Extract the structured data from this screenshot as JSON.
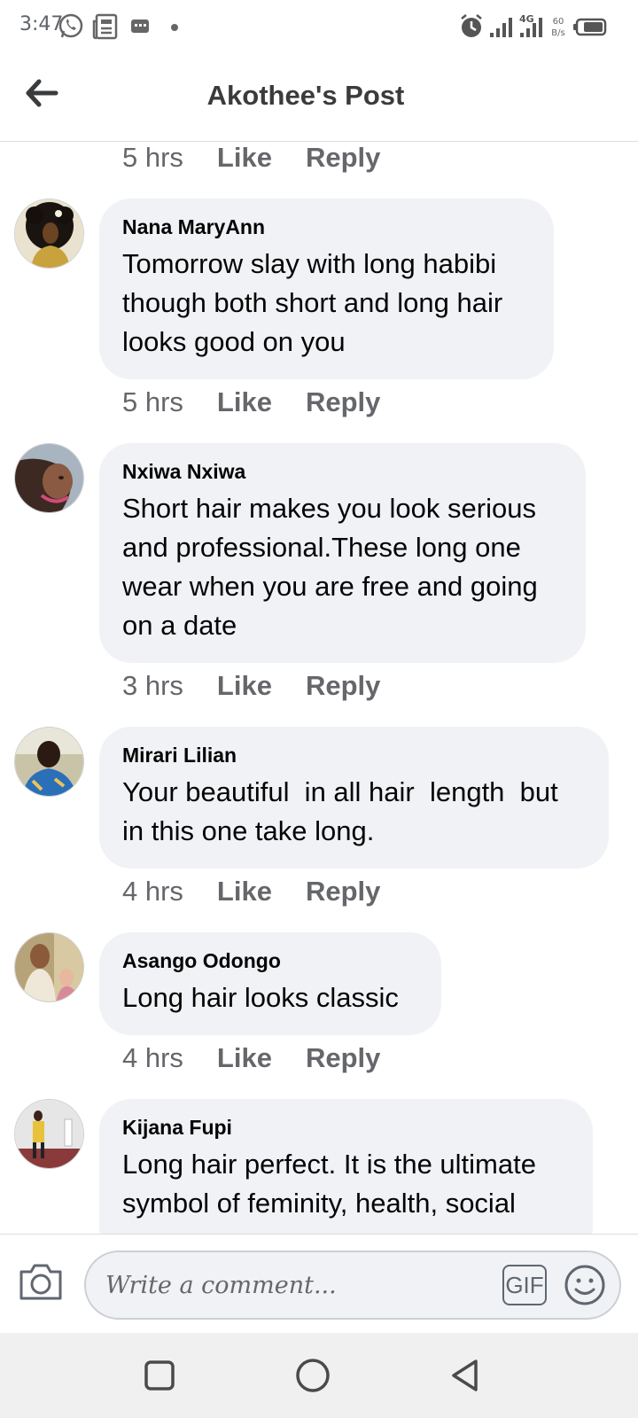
{
  "status_bar": {
    "time": "3:47",
    "icons": [
      "whatsapp-icon",
      "news-icon",
      "message-icon",
      "alarm-icon",
      "signal-icon",
      "signal-4g-icon",
      "data-speed-icon",
      "battery-icon"
    ],
    "network": "4G",
    "speed": "60 B/s"
  },
  "header": {
    "title": "Akothee's Post",
    "back_icon": "back-arrow-icon"
  },
  "top_action_row": {
    "time": "5 hrs",
    "like": "Like",
    "reply": "Reply"
  },
  "comments": [
    {
      "author": "Nana MaryAnn",
      "text": "Tomorrow slay with long habibi\nthough both short and long hair\nlooks good on you",
      "time": "5 hrs",
      "like": "Like",
      "reply": "Reply"
    },
    {
      "author": "Nxiwa Nxiwa",
      "text": "Short hair makes you look serious\nand professional.These long one\nwear when you are free and going\non a date",
      "time": "3 hrs",
      "like": "Like",
      "reply": "Reply"
    },
    {
      "author": "Mirari Lilian",
      "text": "Your beautiful  in all hair  length  but\nin this one take long.",
      "time": "4 hrs",
      "like": "Like",
      "reply": "Reply"
    },
    {
      "author": "Asango Odongo",
      "text": "Long hair looks classic",
      "time": "4 hrs",
      "like": "Like",
      "reply": "Reply"
    },
    {
      "author": "Kijana Fupi",
      "text": "Long hair perfect. It is the ultimate\nsymbol of feminity, health, social"
    }
  ],
  "composer": {
    "placeholder": "Write a comment...",
    "gif_label": "GIF",
    "camera_icon": "camera-icon",
    "emoji_icon": "emoji-icon"
  },
  "navbar": {
    "icons": [
      "recents-square-icon",
      "home-circle-icon",
      "back-triangle-icon"
    ]
  },
  "colors": {
    "bubble": "#f0f2f5",
    "secondary_text": "#65676b",
    "title": "#3a3b3c",
    "divider": "#dadde1",
    "navbar": "#f0f0f0"
  }
}
